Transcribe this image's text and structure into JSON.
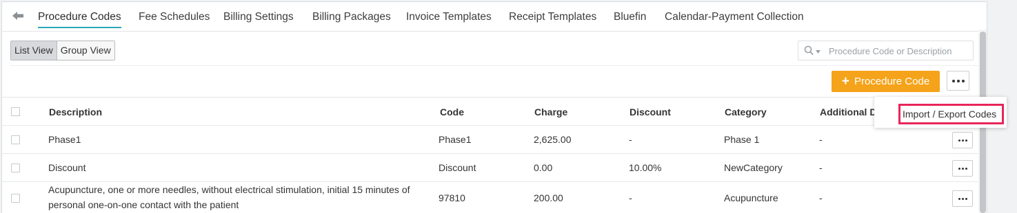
{
  "tabs": [
    {
      "label": "Procedure Codes",
      "active": true
    },
    {
      "label": "Fee Schedules"
    },
    {
      "label": "Billing Settings"
    },
    {
      "label": "Billing Packages"
    },
    {
      "label": "Invoice Templates"
    },
    {
      "label": "Receipt Templates"
    },
    {
      "label": "Bluefin"
    },
    {
      "label": "Calendar-Payment Collection"
    }
  ],
  "view_toggle": {
    "list": "List View",
    "group": "Group View",
    "selected": "List View"
  },
  "search": {
    "placeholder": "Procedure Code or Description",
    "value": ""
  },
  "actions": {
    "add_label": "Procedure Code",
    "more_icon": "ellipsis-icon"
  },
  "dropdown": {
    "items": [
      "Import / Export Codes"
    ],
    "highlight_color": "#e8255a"
  },
  "table": {
    "columns": [
      "Description",
      "Code",
      "Charge",
      "Discount",
      "Category",
      "Additional D"
    ],
    "rows": [
      {
        "description": "Phase1",
        "code": "Phase1",
        "charge": "2,625.00",
        "discount": "-",
        "category": "Phase 1",
        "additional": "-"
      },
      {
        "description": "Discount",
        "code": "Discount",
        "charge": "0.00",
        "discount": "10.00%",
        "category": "NewCategory",
        "additional": "-"
      },
      {
        "description": "Acupuncture, one or more needles, without electrical stimulation, initial 15 minutes of personal one-on-one contact with the patient",
        "code": "97810",
        "charge": "200.00",
        "discount": "-",
        "category": "Acupuncture",
        "additional": "-"
      }
    ]
  },
  "colors": {
    "accent": "#f5a31a",
    "tab_underline": "#2aa7b8"
  }
}
